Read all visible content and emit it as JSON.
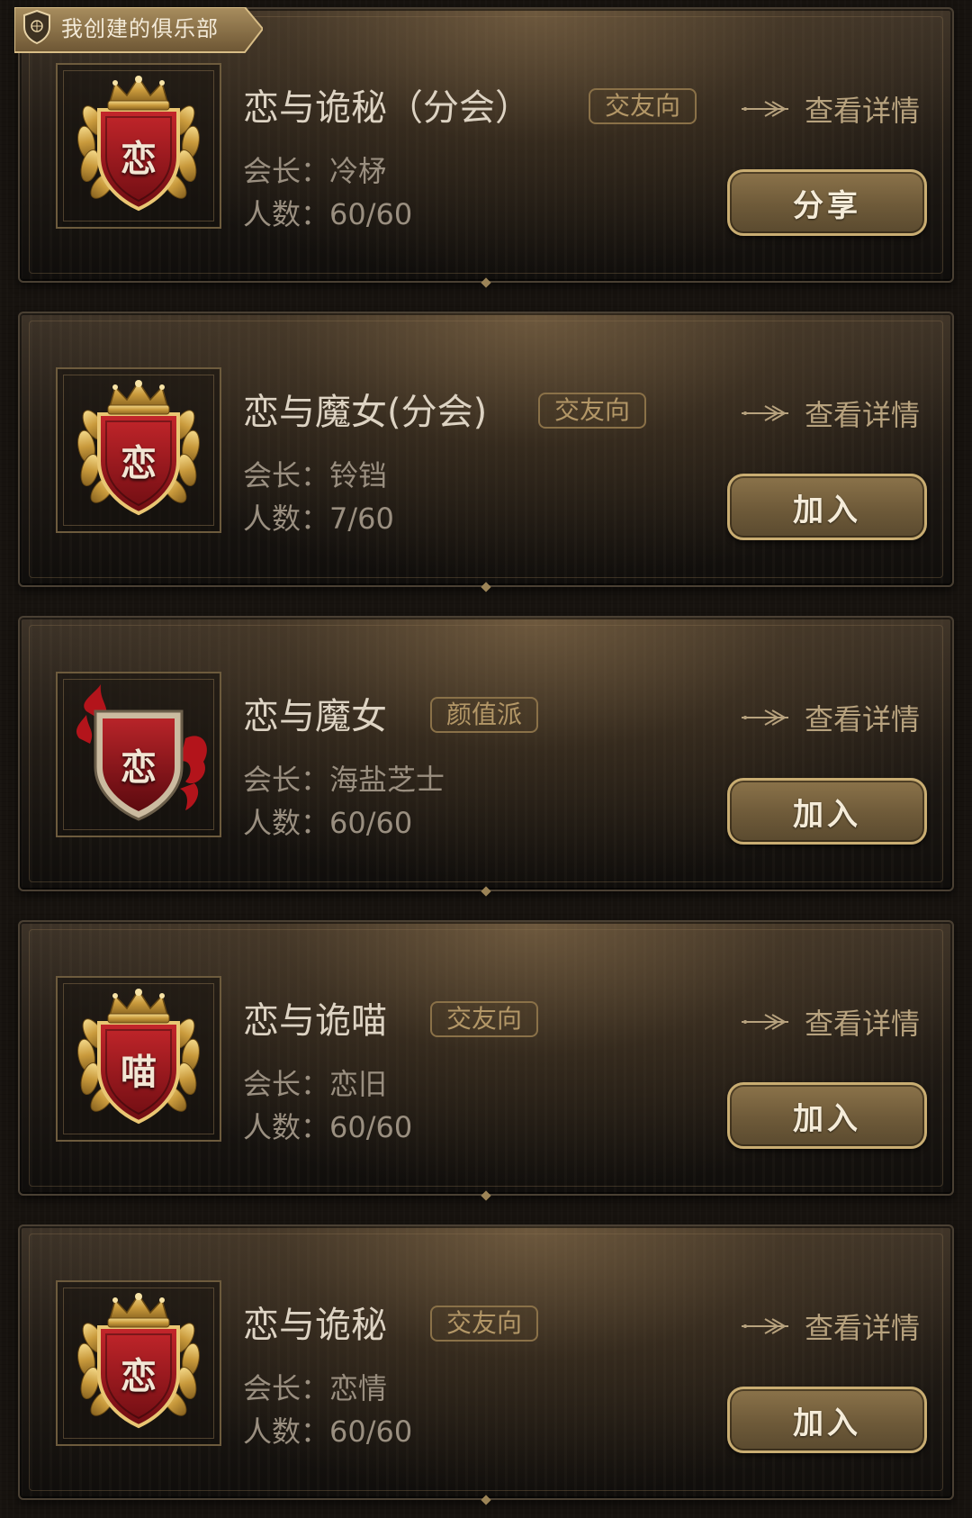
{
  "header": {
    "title": "我创建的俱乐部"
  },
  "labels": {
    "leader_prefix": "会长：",
    "members_prefix": "人数：",
    "view_details": "查看详情"
  },
  "clubs": [
    {
      "name": "恋与诡秘（分会）",
      "tag": "交友向",
      "leader": "冷柕",
      "members": "60/60",
      "emblem_char": "恋",
      "emblem_style": "laurel-crown",
      "action": "分享"
    },
    {
      "name": "恋与魔女(分会)",
      "tag": "交友向",
      "leader": "铃铛",
      "members": "7/60",
      "emblem_char": "恋",
      "emblem_style": "laurel-crown",
      "action": "加入"
    },
    {
      "name": "恋与魔女",
      "tag": "颜值派",
      "leader": "海盐芝士",
      "members": "60/60",
      "emblem_char": "恋",
      "emblem_style": "dragon-shield",
      "action": "加入"
    },
    {
      "name": "恋与诡喵",
      "tag": "交友向",
      "leader": "恋旧",
      "members": "60/60",
      "emblem_char": "喵",
      "emblem_style": "laurel-crown",
      "action": "加入"
    },
    {
      "name": "恋与诡秘",
      "tag": "交友向",
      "leader": "恋情",
      "members": "60/60",
      "emblem_char": "恋",
      "emblem_style": "laurel-crown",
      "action": "加入"
    }
  ],
  "colors": {
    "accent_gold": "#c9ad72",
    "emblem_red": "#a01a1f",
    "text_primary": "#ddd3c3",
    "text_secondary": "#9a8f80"
  }
}
